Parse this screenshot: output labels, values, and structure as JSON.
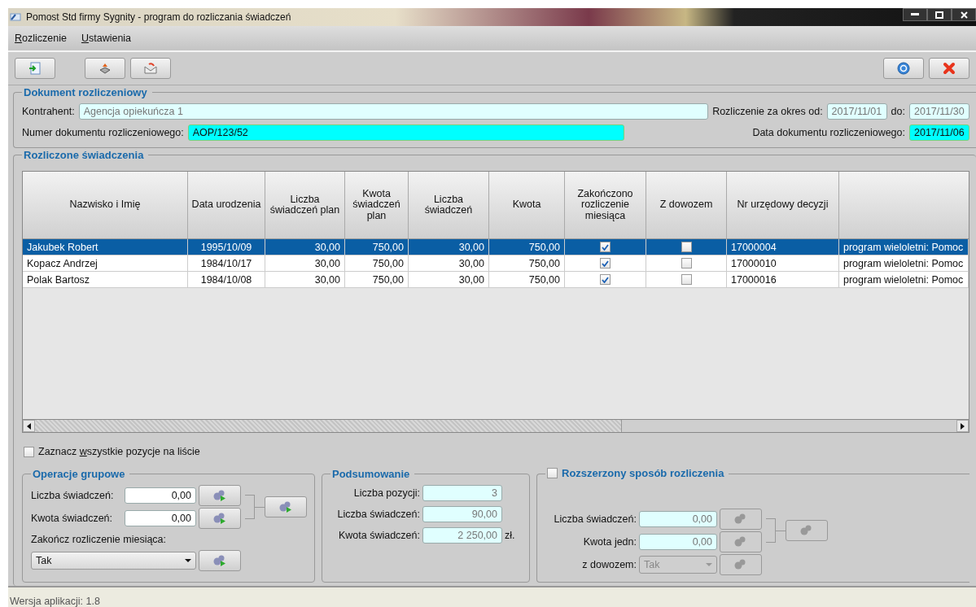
{
  "window": {
    "title": "Pomost Std firmy Sygnity - program do rozliczania świadczeń"
  },
  "menu": [
    {
      "accel": "R",
      "rest": "ozliczenie"
    },
    {
      "accel": "U",
      "rest": "stawienia"
    }
  ],
  "document": {
    "title": "Dokument rozliczeniowy",
    "contractor_label": "Kontrahent:",
    "contractor": "Agencja opiekuńcza 1",
    "period_label": "Rozliczenie za okres od:",
    "period_from": "2017/11/01",
    "to_label": "do:",
    "period_to": "2017/11/30",
    "number_label": "Numer dokumentu rozliczeniowego:",
    "number": "AOP/123/52",
    "date_label": "Data dokumentu rozliczeniowego:",
    "date": "2017/11/06"
  },
  "table": {
    "title": "Rozliczone świadczenia",
    "columns": [
      "Nazwisko i Imię",
      "Data urodzenia",
      "Liczba świadczeń plan",
      "Kwota świadczeń plan",
      "Liczba świadczeń",
      "Kwota",
      "Zakończono rozliczenie miesiąca",
      "Z dowozem",
      "Nr urzędowy decyzji"
    ],
    "rows": [
      {
        "selected": true,
        "name": "Jakubek Robert",
        "birth": "1995/10/09",
        "plan_count": "30,00",
        "plan_amount": "750,00",
        "count": "30,00",
        "amount": "750,00",
        "finished": true,
        "transport": false,
        "decision": "17000004",
        "column_10": "program wieloletni: Pomoc"
      },
      {
        "selected": false,
        "name": "Kopacz Andrzej",
        "birth": "1984/10/17",
        "plan_count": "30,00",
        "plan_amount": "750,00",
        "count": "30,00",
        "amount": "750,00",
        "finished": true,
        "transport": false,
        "decision": "17000010",
        "column_10": "program wieloletni: Pomoc"
      },
      {
        "selected": false,
        "name": "Polak Bartosz",
        "birth": "1984/10/08",
        "plan_count": "30,00",
        "plan_amount": "750,00",
        "count": "30,00",
        "amount": "750,00",
        "finished": true,
        "transport": false,
        "decision": "17000016",
        "column_10": "program wieloletni: Pomoc"
      }
    ]
  },
  "select_all": {
    "before": "Zaznacz ",
    "accel": "w",
    "after": "szystkie pozycje na liście",
    "checked": false
  },
  "group_ops": {
    "title": "Operacje grupowe",
    "fields": [
      {
        "label": "Liczba świadczeń:",
        "value": "0,00"
      },
      {
        "label": "Kwota świadczeń:",
        "value": "0,00"
      }
    ],
    "month_label": "Zakończ rozliczenie miesiąca:",
    "month_value": "Tak"
  },
  "summary": {
    "title": "Podsumowanie",
    "rows": [
      {
        "label": "Liczba pozycji:",
        "value": "3"
      },
      {
        "label": "Liczba świadczeń:",
        "value": "90,00"
      },
      {
        "label": "Kwota świadczeń:",
        "value": "2 250,00",
        "unit": "zł."
      }
    ]
  },
  "extended": {
    "title": "Rozszerzony sposób rozliczenia",
    "checked": false,
    "fields": [
      {
        "label": "Liczba świadczeń:",
        "value": "0,00"
      },
      {
        "label": "Kwota jedn:",
        "value": "0,00"
      }
    ],
    "transport_label": "z dowozem:",
    "transport_value": "Tak"
  },
  "status_bar": "Wersja aplikacji: 1.8"
}
